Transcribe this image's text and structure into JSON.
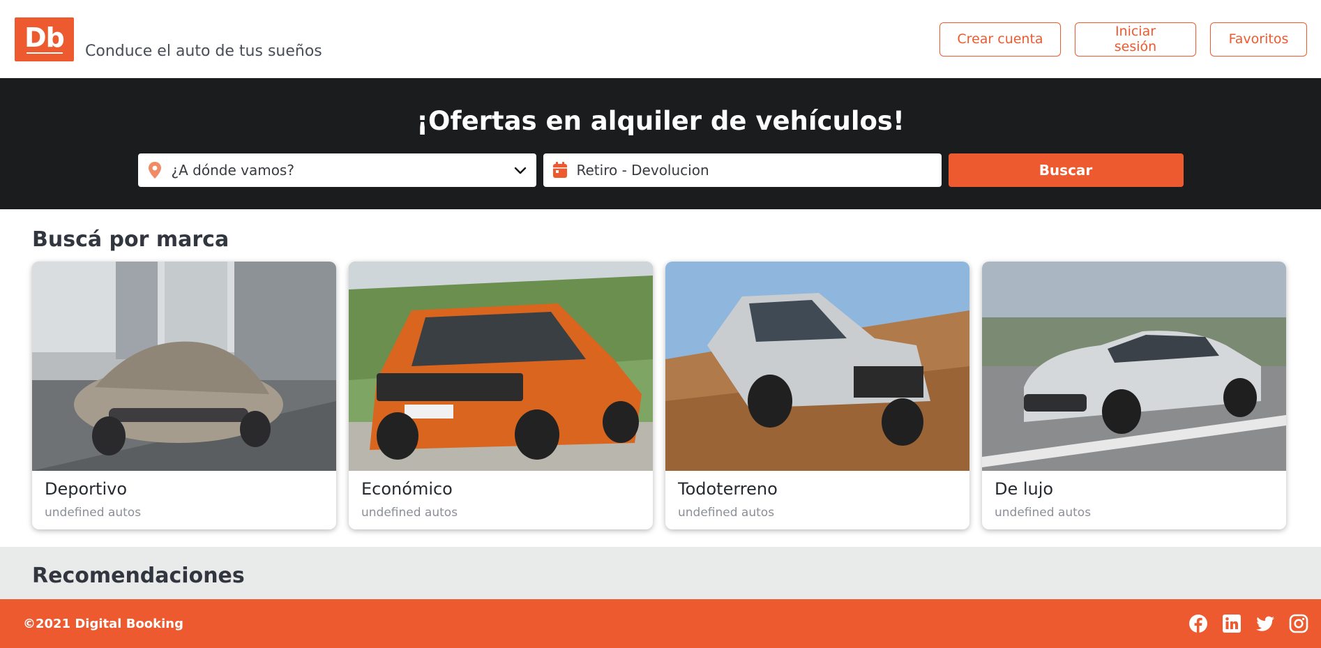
{
  "header": {
    "logo_text": "Db",
    "tagline": "Conduce el auto de tus sueños",
    "nav": {
      "create_account": "Crear cuenta",
      "login": "Iniciar sesión",
      "favorites": "Favoritos"
    }
  },
  "search": {
    "title": "¡Ofertas en alquiler de vehículos!",
    "location_placeholder": "¿A dónde vamos?",
    "dates_placeholder": "Retiro - Devolucion",
    "button_label": "Buscar"
  },
  "categories": {
    "title": "Buscá por marca",
    "items": [
      {
        "title": "Deportivo",
        "subtitle": "undefined autos"
      },
      {
        "title": "Económico",
        "subtitle": "undefined autos"
      },
      {
        "title": "Todoterreno",
        "subtitle": "undefined autos"
      },
      {
        "title": "De lujo",
        "subtitle": "undefined autos"
      }
    ]
  },
  "recommendations": {
    "title": "Recomendaciones"
  },
  "footer": {
    "copyright": "©2021 Digital Booking",
    "socials": [
      "facebook-icon",
      "linkedin-icon",
      "twitter-icon",
      "instagram-icon"
    ]
  },
  "colors": {
    "accent": "#ee5a2f",
    "dark_band": "#1b1c1e",
    "reco_bg": "#e9eaea"
  }
}
